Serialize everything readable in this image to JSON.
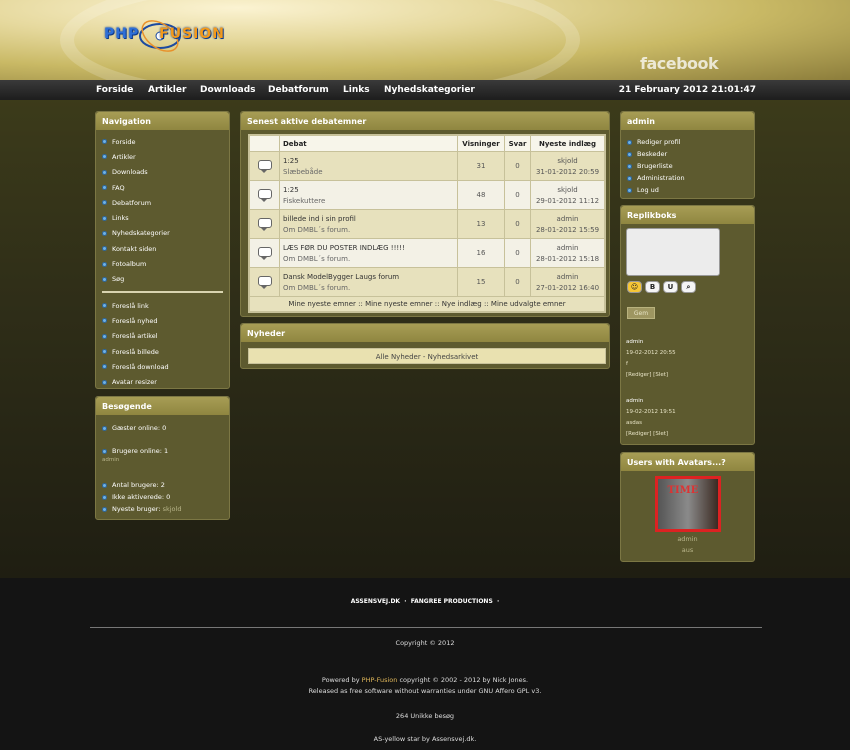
{
  "header": {
    "logo_text_a": "PHP",
    "logo_text_b": "FUSION",
    "facebook_label": "facebook"
  },
  "menu": {
    "items": [
      "Forside",
      "Artikler",
      "Downloads",
      "Debatforum",
      "Links",
      "Nyhedskategorier"
    ],
    "date": "21 February 2012 21:01:47"
  },
  "navigation": {
    "title": "Navigation",
    "items_a": [
      "Forside",
      "Artikler",
      "Downloads",
      "FAQ",
      "Debatforum",
      "Links",
      "Nyhedskategorier",
      "Kontakt siden",
      "Fotoalbum",
      "Søg"
    ],
    "items_b": [
      "Foreslå link",
      "Foreslå nyhed",
      "Foreslå artikel",
      "Foreslå billede",
      "Foreslå download",
      "Avatar resizer"
    ]
  },
  "visitors": {
    "title": "Besøgende",
    "guests": "Gæster online: 0",
    "members": "Brugere online: 1",
    "member_name": "admin",
    "total": "Antal brugere: 2",
    "inactive_label": "Ikke aktiverede",
    "inactive_value": ": 0",
    "newest_label": "Nyeste bruger:",
    "newest_value": "skjold"
  },
  "forum": {
    "title": "Senest aktive debatemner",
    "headers": [
      "",
      "Debat",
      "Visninger",
      "Svar",
      "Nyeste indlæg"
    ],
    "rows": [
      {
        "title": "1:25",
        "sub": "Slæbebåde",
        "views": "31",
        "replies": "0",
        "user": "skjold",
        "date": "31-01-2012 20:59"
      },
      {
        "title": "1:25",
        "sub": "Fiskekuttere",
        "views": "48",
        "replies": "0",
        "user": "skjold",
        "date": "29-01-2012 11:12"
      },
      {
        "title": "billede ind i sin profil",
        "sub": "Om DMBL´s forum.",
        "views": "13",
        "replies": "0",
        "user": "admin",
        "date": "28-01-2012 15:59"
      },
      {
        "title": "LÆS FØR DU POSTER INDLÆG !!!!!",
        "sub": "Om DMBL´s forum.",
        "views": "16",
        "replies": "0",
        "user": "admin",
        "date": "28-01-2012 15:18"
      },
      {
        "title": "Dansk ModelBygger Laugs forum",
        "sub": "Om DMBL´s forum.",
        "views": "15",
        "replies": "0",
        "user": "admin",
        "date": "27-01-2012 16:40"
      }
    ],
    "footer_links": [
      "Mine nyeste emner",
      "Mine nyeste emner",
      "Nye indlæg",
      "Mine udvalgte emner"
    ]
  },
  "news": {
    "title": "Nyheder",
    "link": "Alle Nyheder - Nyhedsarkivet"
  },
  "admin_panel": {
    "title": "admin",
    "items": [
      "Rediger profil",
      "Beskeder",
      "Brugerliste",
      "Administration",
      "Log ud"
    ]
  },
  "shoutbox": {
    "title": "Replikboks",
    "buttons": [
      "B",
      "U"
    ],
    "submit": "Gem",
    "posts": [
      {
        "user": "admin",
        "time": "19-02-2012 20:55",
        "text": "f",
        "edit": "Rediger",
        "delete": "Slet"
      },
      {
        "user": "admin",
        "time": "19-02-2012 19:51",
        "text": "asdas",
        "edit": "Rediger",
        "delete": "Slet"
      }
    ]
  },
  "avatars": {
    "title": "Users with Avatars...?",
    "users": [
      "admin",
      "aus"
    ]
  },
  "footer": {
    "links": [
      "ASSENSVEJ.DK",
      "FANGREE PRODUCTIONS"
    ],
    "copyright": "Copyright © 2012",
    "powered_a": "Powered by",
    "powered_link": "PHP-Fusion",
    "powered_b": "copyright © 2002 - 2012 by Nick Jones.",
    "powered_c": "Released as free software without warranties under GNU Affero GPL v3.",
    "visits": "264 Unikke besøg",
    "credit": "AS-yellow star by Assensvej.dk."
  }
}
